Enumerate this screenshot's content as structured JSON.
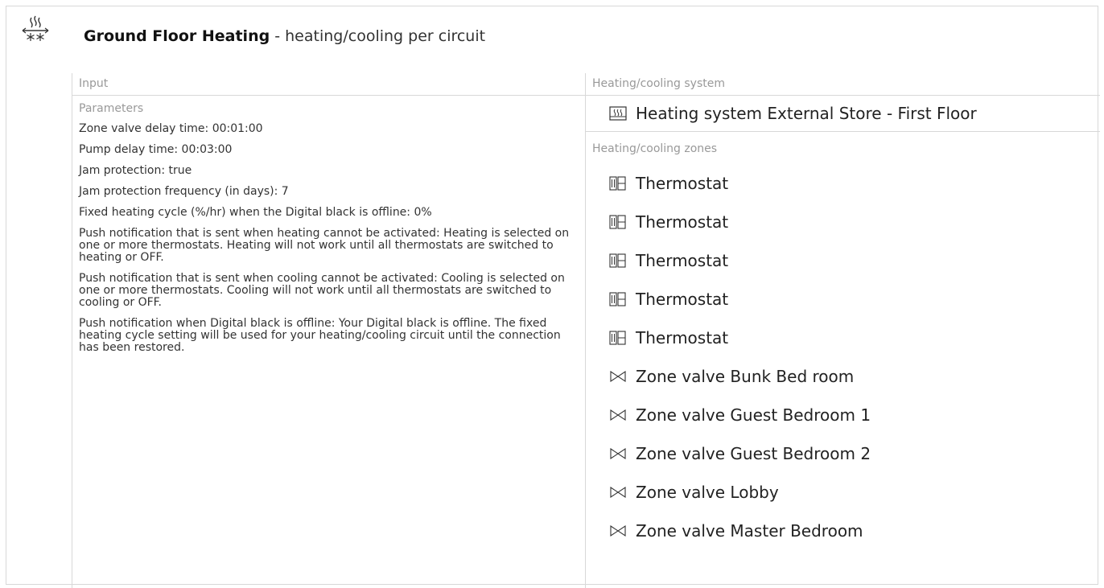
{
  "header": {
    "logo_icon": "heating-cooling-icon",
    "title_bold": "Ground Floor Heating",
    "title_suffix": " - heating/cooling per circuit"
  },
  "input": {
    "label": "Input",
    "parameters_label": "Parameters",
    "parameters": [
      "Zone valve delay time: 00:01:00",
      "Pump delay time: 00:03:00",
      "Jam protection: true",
      "Jam protection frequency (in days): 7",
      "Fixed heating cycle (%/hr) when the Digital black is offline: 0%",
      "Push notification that is sent when heating cannot be activated: Heating is selected on one or more thermostats. Heating will not work until all thermostats are switched to heating or OFF.",
      "Push notification that is sent when cooling cannot be activated: Cooling is selected on one or more thermostats. Cooling will not work until all thermostats are switched to cooling or OFF.",
      "Push notification when Digital black is offline: Your Digital black is offline. The fixed heating cycle setting will be used for your heating/cooling circuit until the connection has been restored."
    ]
  },
  "system": {
    "label": "Heating/cooling system",
    "icon": "heating-system-icon",
    "name": "Heating system External Store - First Floor"
  },
  "zones": {
    "label": "Heating/cooling zones",
    "items": [
      {
        "icon": "thermostat-icon",
        "label": "Thermostat"
      },
      {
        "icon": "thermostat-icon",
        "label": "Thermostat"
      },
      {
        "icon": "thermostat-icon",
        "label": "Thermostat"
      },
      {
        "icon": "thermostat-icon",
        "label": "Thermostat"
      },
      {
        "icon": "thermostat-icon",
        "label": "Thermostat"
      },
      {
        "icon": "valve-icon",
        "label": "Zone valve Bunk Bed room"
      },
      {
        "icon": "valve-icon",
        "label": "Zone valve Guest Bedroom 1"
      },
      {
        "icon": "valve-icon",
        "label": "Zone valve Guest Bedroom 2"
      },
      {
        "icon": "valve-icon",
        "label": "Zone valve Lobby"
      },
      {
        "icon": "valve-icon",
        "label": "Zone valve Master Bedroom"
      }
    ]
  }
}
